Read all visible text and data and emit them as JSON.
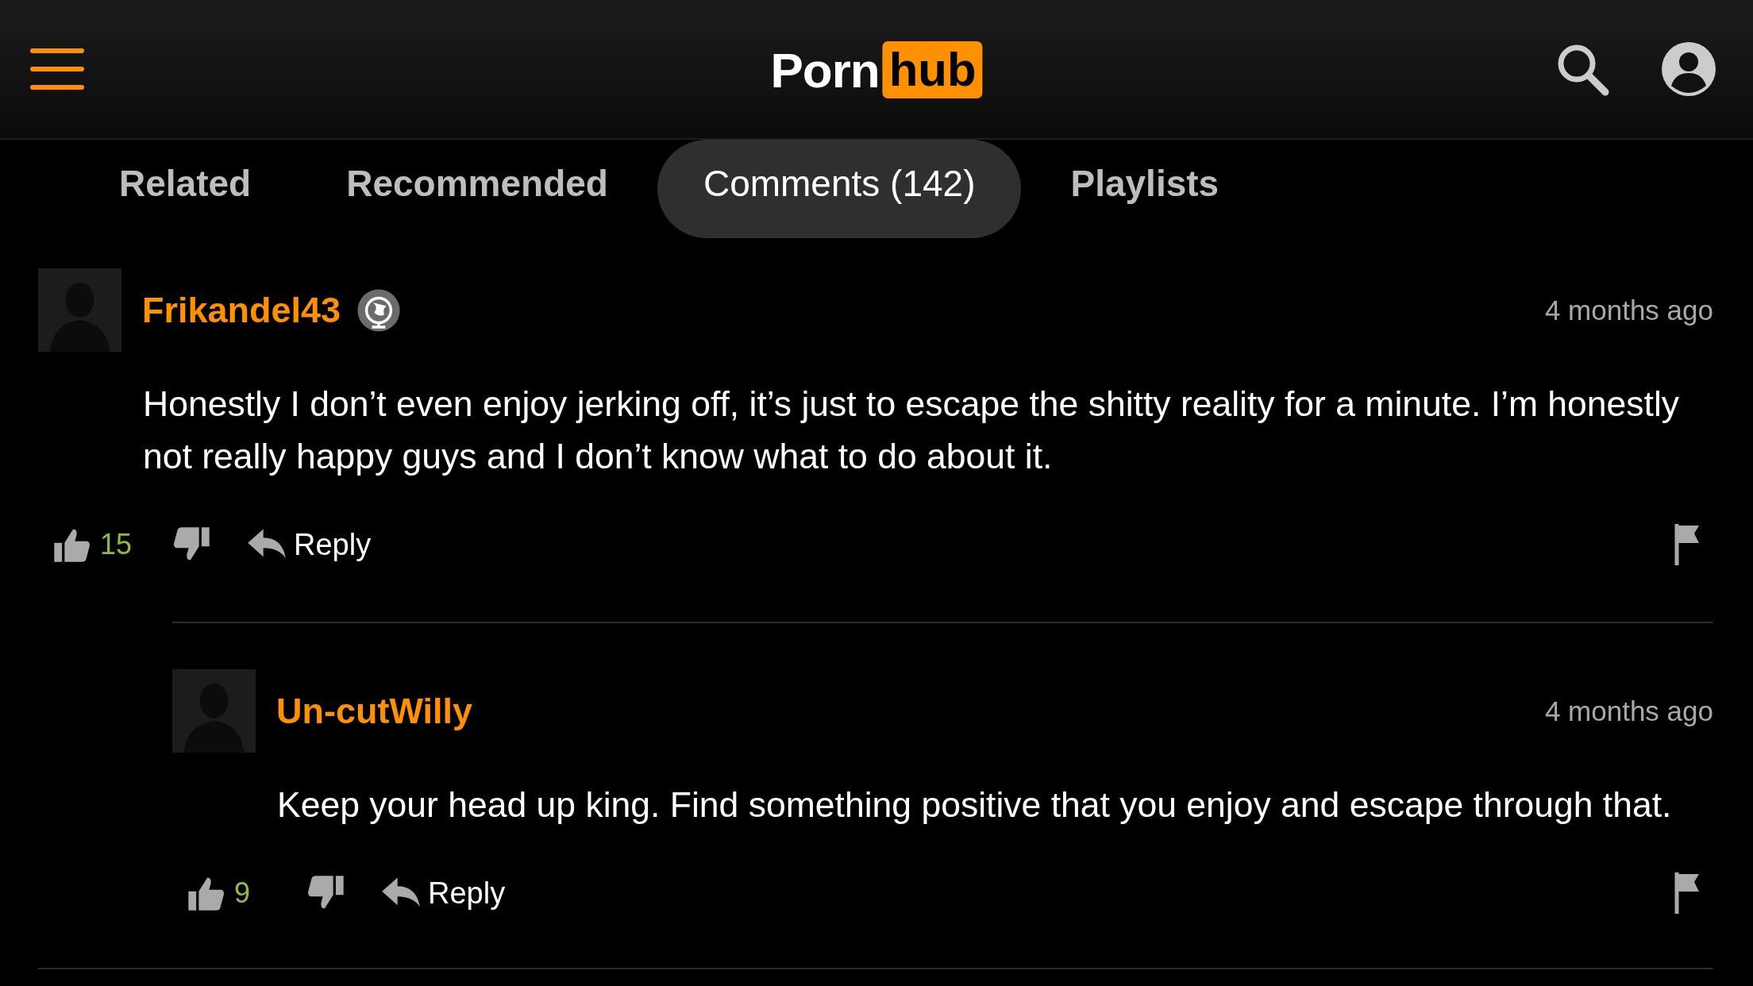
{
  "header": {
    "logo_left": "Porn",
    "logo_right": "hub"
  },
  "tabs": [
    {
      "label": "Related",
      "selected": false
    },
    {
      "label": "Recommended",
      "selected": false
    },
    {
      "label": "Comments (142)",
      "selected": true
    },
    {
      "label": "Playlists",
      "selected": false
    }
  ],
  "comments": [
    {
      "username": "Frikandel43",
      "badge": true,
      "time": "4 months ago",
      "text": "Honestly I don’t even enjoy jerking off, it’s just to escape the shitty reality for a minute. I’m honestly not really happy guys and I don’t know what to do about it.",
      "likes": "15",
      "reply": "Reply",
      "children": [
        {
          "username": "Un-cutWilly",
          "badge": false,
          "time": "4 months ago",
          "text": "Keep your head up king. Find something positive that you enjoy and escape through that.",
          "likes": "9",
          "reply": "Reply"
        }
      ]
    }
  ]
}
